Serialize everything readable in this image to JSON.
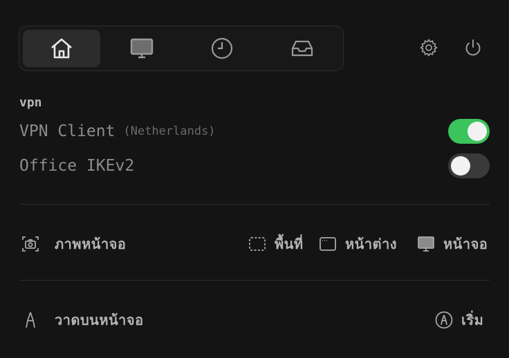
{
  "tabs": [
    {
      "name": "home",
      "icon": "home-icon",
      "active": true
    },
    {
      "name": "display",
      "icon": "monitor-icon",
      "active": false
    },
    {
      "name": "history",
      "icon": "clock-icon",
      "active": false
    },
    {
      "name": "inbox",
      "icon": "inbox-icon",
      "active": false
    }
  ],
  "header_icons": [
    "gear-icon",
    "power-icon"
  ],
  "vpn": {
    "section_label": "vpn",
    "items": [
      {
        "name": "VPN Client",
        "detail": "(Netherlands)",
        "enabled": true
      },
      {
        "name": "Office IKEv2",
        "detail": "",
        "enabled": false
      }
    ]
  },
  "screenshot": {
    "label": "ภาพหน้าจอ",
    "options": [
      {
        "label": "พื้นที่",
        "icon": "dashed-area-icon"
      },
      {
        "label": "หน้าต่าง",
        "icon": "window-icon"
      },
      {
        "label": "หน้าจอ",
        "icon": "monitor-icon"
      }
    ]
  },
  "draw": {
    "label": "วาดบนหน้าจอ",
    "start_label": "เริ่ม"
  },
  "colors": {
    "background": "#141414",
    "toggle_on": "#3bc35c",
    "toggle_off": "#3a3a3a"
  }
}
